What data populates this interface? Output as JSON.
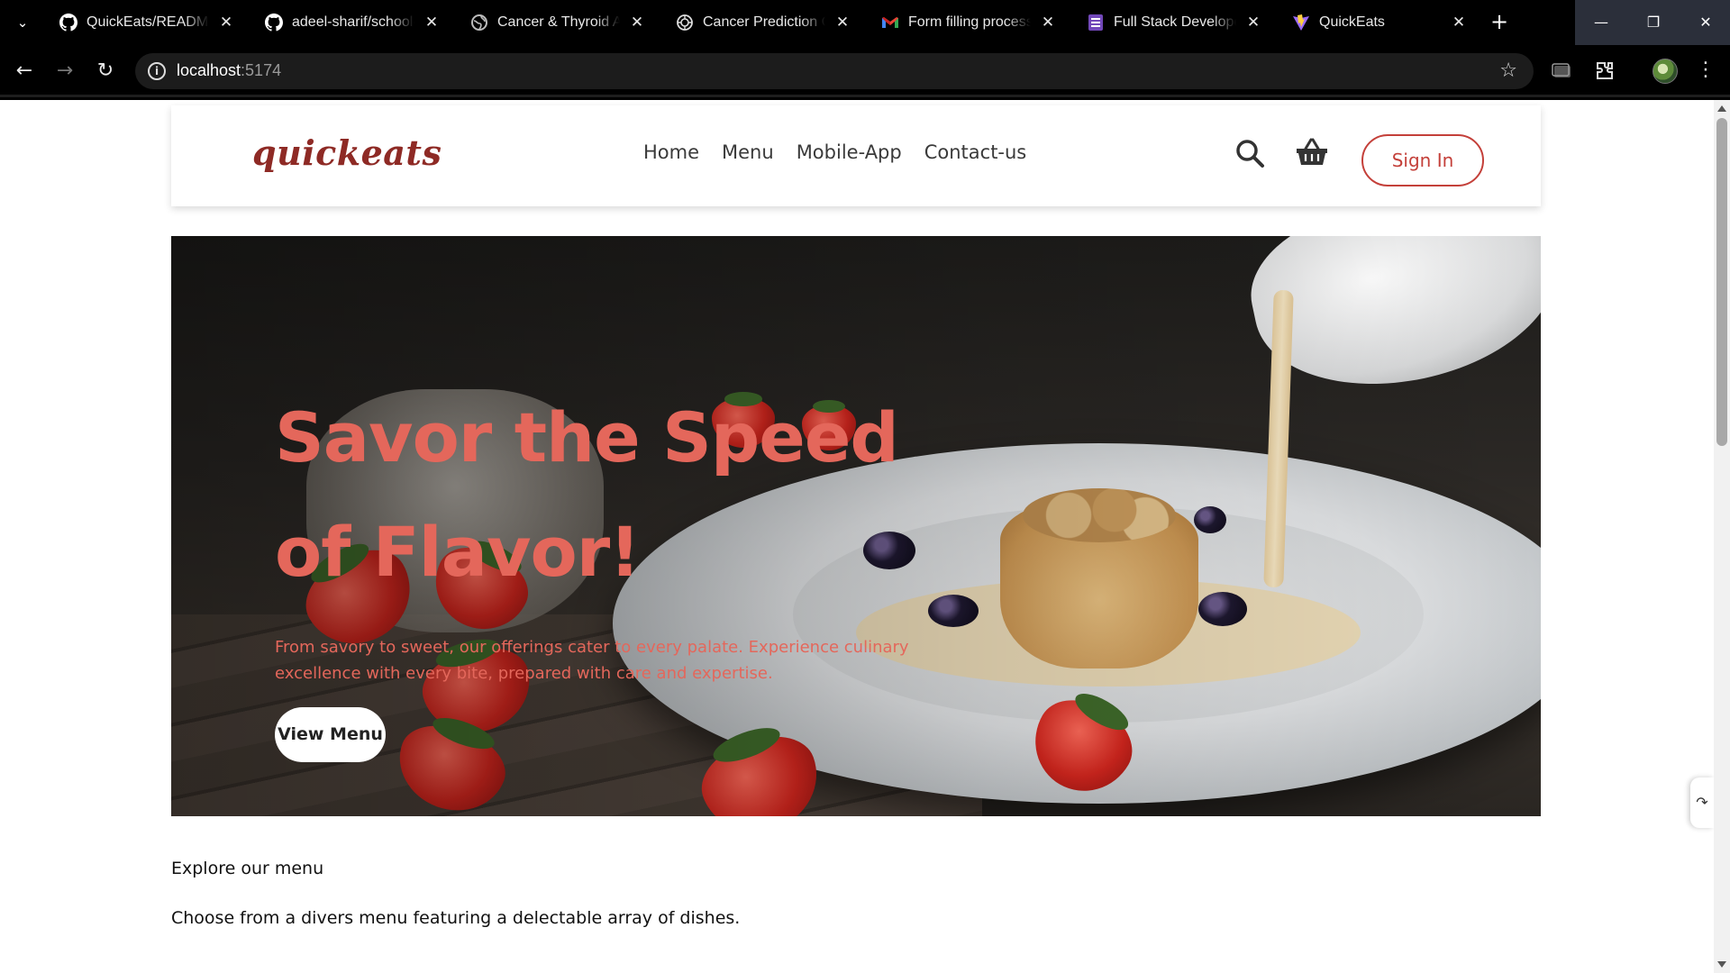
{
  "browser": {
    "tabs": [
      {
        "title": "QuickEats/README.md",
        "icon": "github-icon",
        "active": false
      },
      {
        "title": "adeel-sharif/school-m",
        "icon": "github-icon",
        "active": false
      },
      {
        "title": "Cancer & Thyroid Aw",
        "icon": "globe-icon",
        "active": false
      },
      {
        "title": "Cancer Prediction Ch",
        "icon": "openai-icon",
        "active": false
      },
      {
        "title": "Form filling process c",
        "icon": "gmail-icon",
        "active": false
      },
      {
        "title": "Full Stack Developer",
        "icon": "forms-icon",
        "active": false
      },
      {
        "title": "QuickEats",
        "icon": "vite-icon",
        "active": true
      }
    ],
    "url_host": "localhost",
    "url_port": ":5174"
  },
  "site": {
    "logo": "quickeats",
    "nav": [
      "Home",
      "Menu",
      "Mobile-App",
      "Contact-us"
    ],
    "signin_label": "Sign In",
    "hero": {
      "title": "Savor the Speed of Flavor!",
      "text": "From savory to sweet, our offerings cater to every palate. Experience culinary excellence with every bite, prepared with care and expertise.",
      "button_label": "View Menu"
    },
    "explore": {
      "title": "Explore our menu",
      "subtitle": "Choose from a divers menu featuring a delectable array of dishes."
    }
  },
  "colors": {
    "accent": "#c4403a",
    "hero_text": "#e4675b",
    "logo": "#8e2a25"
  }
}
